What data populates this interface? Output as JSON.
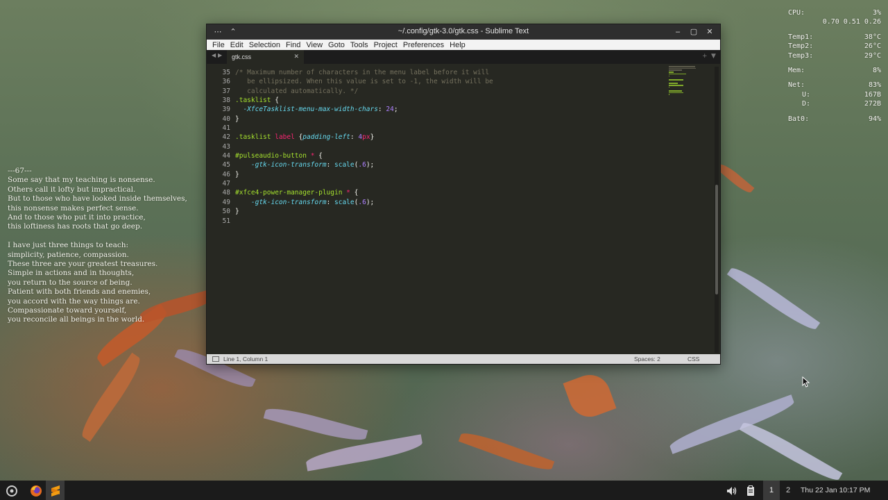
{
  "window": {
    "title": "~/.config/gtk-3.0/gtk.css - Sublime Text",
    "menu": [
      "File",
      "Edit",
      "Selection",
      "Find",
      "View",
      "Goto",
      "Tools",
      "Project",
      "Preferences",
      "Help"
    ],
    "tab_name": "gtk.css",
    "line_numbers": [
      "35",
      "36",
      "37",
      "38",
      "39",
      "40",
      "41",
      "42",
      "43",
      "44",
      "45",
      "46",
      "47",
      "48",
      "49",
      "50",
      "51"
    ],
    "code": [
      "/* Maximum number of characters in the menu label before it will",
      "   be ellipsized. When this value is set to -1, the width will be",
      "   calculated automatically. */",
      ".tasklist {",
      "  -XfceTasklist-menu-max-width-chars: 24;",
      "}",
      "",
      ".tasklist label {padding-left: 4px}",
      "",
      "#pulseaudio-button * {",
      "    -gtk-icon-transform: scale(.6);",
      "}",
      "",
      "#xfce4-power-manager-plugin * {",
      "    -gtk-icon-transform: scale(.6);",
      "}",
      ""
    ],
    "status": {
      "position": "Line 1, Column 1",
      "spaces": "Spaces: 2",
      "syntax": "CSS"
    }
  },
  "poem": {
    "heading": "---67---",
    "stanza1": [
      "Some say that my teaching is nonsense.",
      "Others call it lofty but impractical.",
      "But to those who have looked inside themselves,",
      "this nonsense makes perfect sense.",
      "And to those who put it into practice,",
      "this loftiness has roots that go deep."
    ],
    "stanza2": [
      "I have just three things to teach:",
      "simplicity, patience, compassion.",
      "These three are your greatest treasures.",
      "Simple in actions and in thoughts,",
      "you return to the source of being.",
      "Patient with both friends and enemies,",
      "you accord with the way things are.",
      "Compassionate toward yourself,",
      "you reconcile all beings in the world."
    ]
  },
  "sysmon": {
    "cpu_label": "CPU:",
    "cpu_value": "3%",
    "load": "0.70 0.51 0.26",
    "temp1_label": "Temp1:",
    "temp1_value": "38°C",
    "temp2_label": "Temp2:",
    "temp2_value": "26°C",
    "temp3_label": "Temp3:",
    "temp3_value": "29°C",
    "mem_label": "Mem:",
    "mem_value": "8%",
    "net_label": "Net:",
    "net_value": "83%",
    "up_label": "U:",
    "up_value": "167B",
    "down_label": "D:",
    "down_value": "272B",
    "bat_label": "Bat0:",
    "bat_value": "94%"
  },
  "taskbar": {
    "workspace_1": "1",
    "workspace_2": "2",
    "clock": "Thu 22 Jan 10:17 PM",
    "icons": [
      "menu-icon",
      "firefox-icon",
      "sublime-icon",
      "volume-icon",
      "clipboard-icon"
    ]
  }
}
